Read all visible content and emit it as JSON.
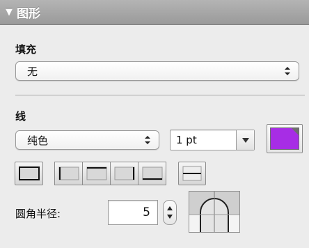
{
  "panel": {
    "title": "图形"
  },
  "fill": {
    "label": "填充",
    "selected": "无"
  },
  "line": {
    "label": "线",
    "style_selected": "纯色",
    "width_value": "1 pt",
    "color": "#a72de5"
  },
  "corner_radius": {
    "label": "圆角半径:",
    "value": "5"
  },
  "icons": {
    "header_toggle": "disclosure-triangle-down-icon",
    "popup_arrows": "up-down-arrows-icon",
    "combo_arrow": "chevron-down-icon"
  }
}
